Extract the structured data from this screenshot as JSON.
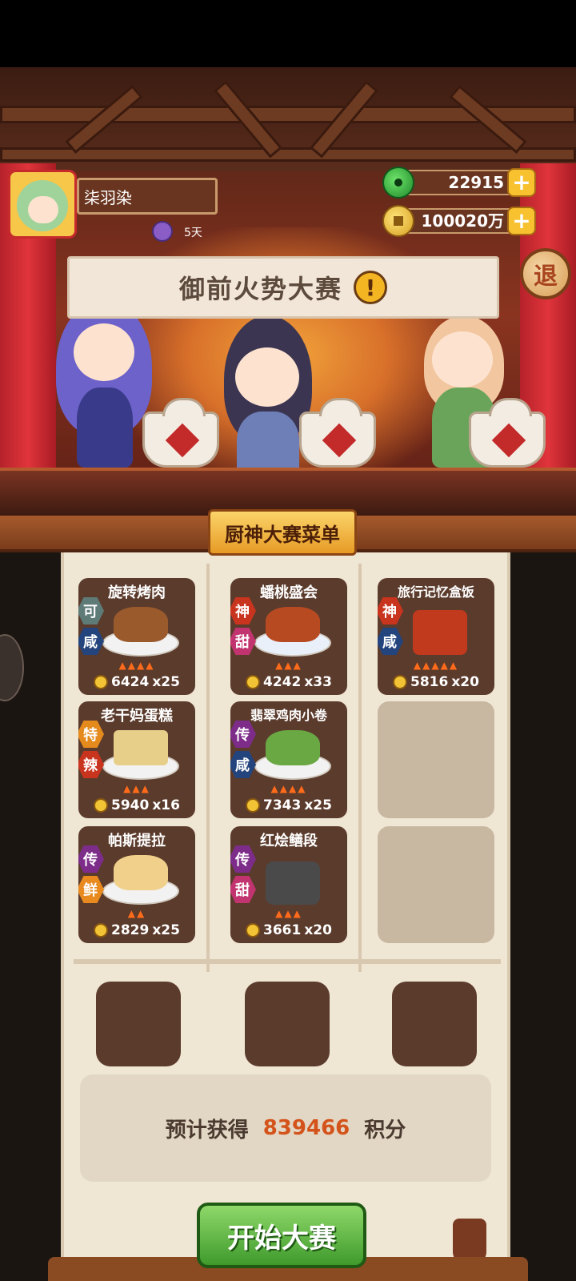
{
  "player": {
    "name": "柒羽染",
    "buff_days": "5天"
  },
  "currency": {
    "jade": "22915",
    "coins": "100020万",
    "plus_label": "+"
  },
  "exit_label": "退",
  "banner": {
    "title": "御前火势大赛",
    "alert": "!"
  },
  "menu": {
    "title": "厨神大赛菜单",
    "dishes": [
      {
        "name": "旋转烤肉",
        "tag1": "可",
        "tag2": "咸",
        "price": "6424",
        "count": "x25"
      },
      {
        "name": "蟠桃盛会",
        "tag1": "神",
        "tag2": "甜",
        "price": "4242",
        "count": "x33"
      },
      {
        "name": "旅行记忆盒饭",
        "tag1": "神",
        "tag2": "咸",
        "price": "5816",
        "count": "x20"
      },
      {
        "name": "老干妈蛋糕",
        "tag1": "特",
        "tag2": "辣",
        "price": "5940",
        "count": "x16"
      },
      {
        "name": "翡翠鸡肉小卷",
        "tag1": "传",
        "tag2": "咸",
        "price": "7343",
        "count": "x25"
      },
      {
        "name": "帕斯提拉",
        "tag1": "传",
        "tag2": "鲜",
        "price": "2829",
        "count": "x25"
      },
      {
        "name": "红烩鳝段",
        "tag1": "传",
        "tag2": "甜",
        "price": "3661",
        "count": "x20"
      }
    ]
  },
  "estimate": {
    "prefix": "预计获得",
    "value": "839466",
    "suffix": "积分"
  },
  "start_button": "开始大赛",
  "colors": {
    "accent": "#d4531a",
    "button_green": "#3f9a2c",
    "board": "#f0e6d4"
  }
}
